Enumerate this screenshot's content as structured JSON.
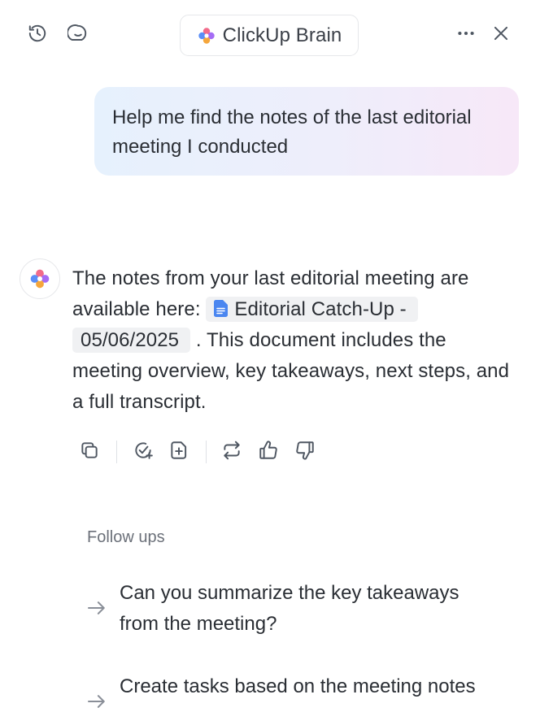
{
  "header": {
    "title": "ClickUp Brain"
  },
  "conversation": {
    "user_message": "Help me find the notes of the last editorial meeting I conducted",
    "assistant": {
      "text_before": "The notes from your last editorial meeting are available here: ",
      "doc_link": "Editorial Catch-Up - 05/06/2025",
      "text_after": " . This document includes the meeting overview, key takeaways, next steps, and a full transcript."
    }
  },
  "follow_ups": {
    "title": "Follow ups",
    "items": [
      {
        "label": "Can you summarize the key takeaways from the meeting?"
      },
      {
        "label": "Create tasks based on the meeting notes"
      }
    ]
  },
  "colors": {
    "bubble_start": "#e6f1fd",
    "bubble_end": "#f7e8f8",
    "doc_icon": "#4a86f0",
    "text": "#2a2e34"
  },
  "icons": [
    "history-icon",
    "new-chat-icon",
    "brain-logo-icon",
    "more-icon",
    "close-icon",
    "copy-icon",
    "create-task-icon",
    "add-doc-icon",
    "regenerate-icon",
    "thumbs-up-icon",
    "thumbs-down-icon",
    "arrow-right-icon",
    "doc-icon"
  ]
}
